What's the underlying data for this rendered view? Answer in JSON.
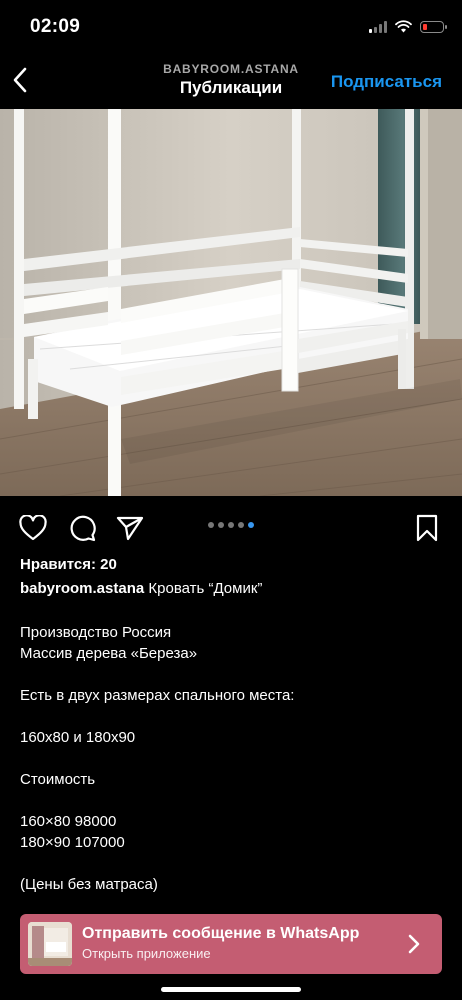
{
  "status_bar": {
    "time": "02:09",
    "battery_color": "#ff3b30"
  },
  "nav": {
    "back_icon": "chevron-left-icon",
    "subtitle": "BABYROOM.ASTANA",
    "title": "Публикации",
    "follow_label": "Подписаться",
    "follow_color": "#1a96f0"
  },
  "post": {
    "image_description_icon": "photo-white-house-bed",
    "carousel": {
      "count": 5,
      "active_index": 4
    },
    "likes": "Нравится: 20",
    "username": "babyroom.astana",
    "caption_title": "Кровать “Домик”",
    "caption_lines": [
      "Производство Россия",
      "Массив дерева «Береза»",
      "",
      "Есть в двух размерах спального места:",
      "",
      "160x80 и 180x90",
      "",
      "Стоимость",
      "",
      "160×80 98000",
      "180×90 107000",
      "",
      "(Цены без матраса)"
    ]
  },
  "whatsapp_bar": {
    "title": "Отправить сообщение в WhatsApp",
    "subtitle": "Открыть приложение",
    "background": "#c45d72"
  }
}
